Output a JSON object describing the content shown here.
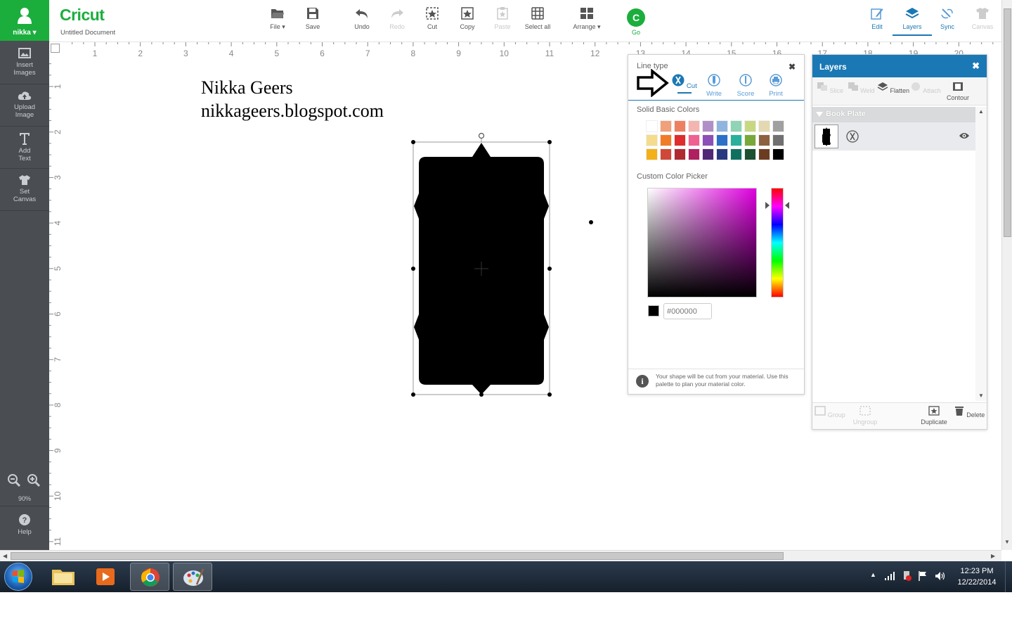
{
  "sidebar": {
    "user": "nikka",
    "items": [
      {
        "line1": "Insert",
        "line2": "Images"
      },
      {
        "line1": "Upload",
        "line2": "Image"
      },
      {
        "line1": "Add",
        "line2": "Text"
      },
      {
        "line1": "Set",
        "line2": "Canvas"
      }
    ],
    "zoom": "90%",
    "help": "Help"
  },
  "header": {
    "logo": "Cricut",
    "document": "Untitled Document",
    "tools": {
      "file": "File",
      "save": "Save",
      "undo": "Undo",
      "redo": "Redo",
      "cut": "Cut",
      "copy": "Copy",
      "paste": "Paste",
      "select_all": "Select all",
      "arrange": "Arrange",
      "go": "Go"
    },
    "right_tabs": {
      "edit": "Edit",
      "layers": "Layers",
      "sync": "Sync",
      "canvas": "Canvas"
    }
  },
  "ruler": {
    "top": [
      "1",
      "2",
      "3",
      "4",
      "5",
      "6",
      "7",
      "8",
      "9",
      "10",
      "11",
      "12",
      "13",
      "14",
      "15",
      "16",
      "17",
      "18",
      "19",
      "20"
    ],
    "left": [
      "1",
      "2",
      "3",
      "4",
      "5",
      "6",
      "7",
      "8",
      "9",
      "10",
      "11"
    ]
  },
  "canvas": {
    "watermark_line1": "Nikka Geers",
    "watermark_line2": "nikkageers.blogspot.com"
  },
  "linetype_panel": {
    "title": "Line type",
    "close": "✖",
    "options": {
      "cut": "Cut",
      "write": "Write",
      "score": "Score",
      "print": "Print"
    },
    "solid_colors_title": "Solid Basic Colors",
    "swatches": [
      "#ffffff",
      "#f0a07a",
      "#ee8062",
      "#f4b4b0",
      "#b08fc8",
      "#8fb4e0",
      "#8fd4b4",
      "#c8d880",
      "#e4d8b0",
      "#a0a0a0",
      "#f4dc8c",
      "#f07c28",
      "#e02c2c",
      "#f06090",
      "#8c50b8",
      "#2c70c8",
      "#28b09c",
      "#78a838",
      "#8c6040",
      "#707070",
      "#f4b018",
      "#d04838",
      "#b02830",
      "#b02060",
      "#502878",
      "#283880",
      "#107060",
      "#1c5030",
      "#6c3c20",
      "#000000"
    ],
    "custom_title": "Custom Color Picker",
    "hex_value": "#000000",
    "info": "Your shape will be cut from your material. Use this palette to plan your material color."
  },
  "layers_panel": {
    "title": "Layers",
    "close": "✖",
    "tools": {
      "slice": "Slice",
      "weld": "Weld",
      "flatten": "Flatten",
      "attach": "Attach",
      "contour": "Contour"
    },
    "group_name": "Book Plate",
    "bottom": {
      "group": "Group",
      "ungroup": "Ungroup",
      "duplicate": "Duplicate",
      "delete": "Delete"
    }
  },
  "taskbar": {
    "time": "12:23 PM",
    "date": "12/22/2014"
  },
  "colors": {
    "brand_green": "#1bae3d",
    "sidebar": "#4a4e53",
    "accent_blue": "#1a78b4"
  }
}
